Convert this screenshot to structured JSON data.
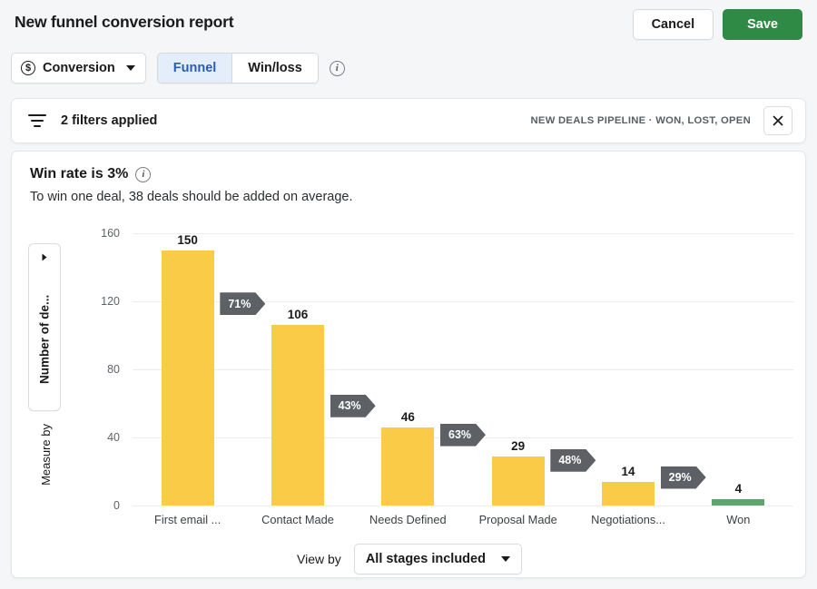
{
  "header": {
    "title": "New funnel conversion report",
    "cancel_label": "Cancel",
    "save_label": "Save"
  },
  "toolbar": {
    "metric_label": "Conversion",
    "metric_icon": "dollar-circle-icon",
    "tabs": [
      {
        "label": "Funnel",
        "active": true
      },
      {
        "label": "Win/loss",
        "active": false
      }
    ],
    "info_icon": "info-icon",
    "info_glyph": "i"
  },
  "filters": {
    "icon": "filter-icon",
    "text": "2 filters applied",
    "meta": "NEW DEALS PIPELINE  ·  WON, LOST, OPEN",
    "close_icon": "close-icon"
  },
  "summary": {
    "title": "Win rate is 3%",
    "info_icon": "info-icon",
    "subtitle": "To win one deal, 38 deals should be added on average."
  },
  "controls": {
    "measure_by_label": "Measure by",
    "measure_value": "Number of de...",
    "view_by_label": "View by",
    "view_by_value": "All stages included"
  },
  "colors": {
    "bar": "#facb46",
    "won_bar": "#61a46d",
    "badge": "#5d6166",
    "accent_blue": "#2a5db0",
    "save_green": "#2f8a46"
  },
  "chart_data": {
    "type": "bar",
    "title": "Win rate is 3%",
    "xlabel": "",
    "ylabel": "Number of deals",
    "ylim": [
      0,
      160
    ],
    "yticks": [
      0,
      40,
      80,
      120,
      160
    ],
    "grid": true,
    "legend": "none",
    "categories": [
      "First email ...",
      "Contact Made",
      "Needs Defined",
      "Proposal Made",
      "Negotiations...",
      "Won"
    ],
    "values": [
      150,
      106,
      46,
      29,
      14,
      4
    ],
    "bar_colors": [
      "#facb46",
      "#facb46",
      "#facb46",
      "#facb46",
      "#facb46",
      "#61a46d"
    ],
    "conversion_labels": [
      "71%",
      "43%",
      "63%",
      "48%",
      "29%"
    ]
  }
}
